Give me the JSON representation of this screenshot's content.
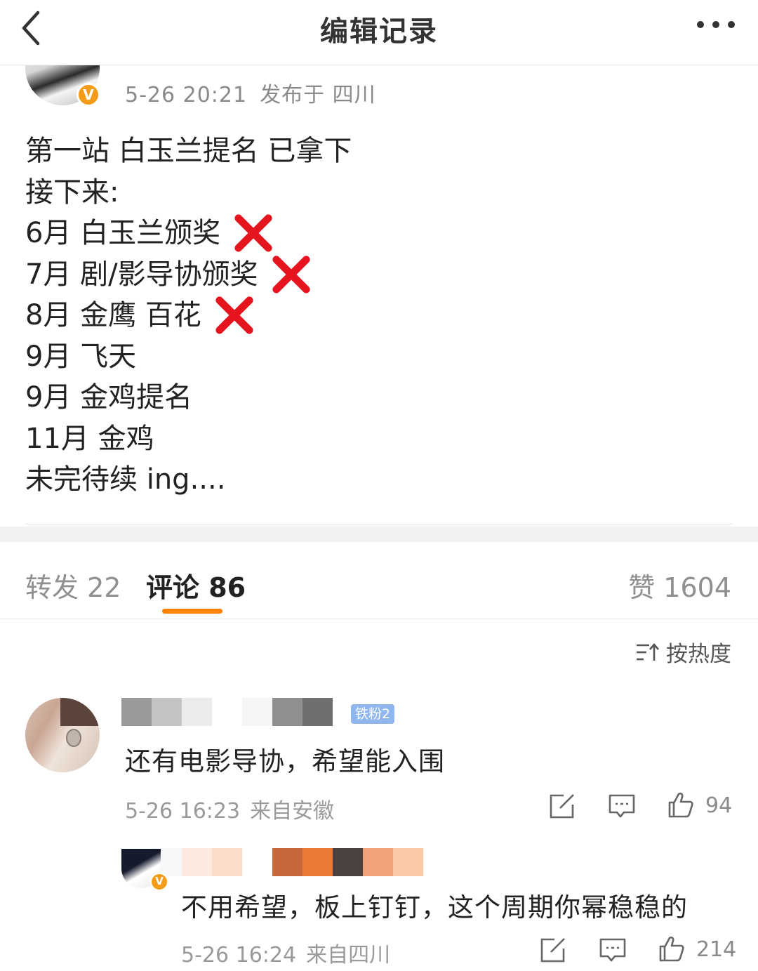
{
  "nav": {
    "title": "编辑记录",
    "back_icon": "chevron-left-icon",
    "more_icon": "more-horizontal-icon"
  },
  "post": {
    "time": "5-26 20:21",
    "location": "发布于 四川",
    "verify_badge": "V",
    "lines": [
      {
        "text": "第一站 白玉兰提名 已拿下",
        "crossed": false
      },
      {
        "text": "接下来:",
        "crossed": false
      },
      {
        "text": "6月 白玉兰颁奖",
        "crossed": true
      },
      {
        "text": "7月 剧/影导协颁奖",
        "crossed": true
      },
      {
        "text": "8月 金鹰 百花",
        "crossed": true
      },
      {
        "text": "9月 飞天",
        "crossed": false
      },
      {
        "text": "9月 金鸡提名",
        "crossed": false
      },
      {
        "text": "11月 金鸡",
        "crossed": false
      },
      {
        "text": "未完待续 ing....",
        "crossed": false
      }
    ]
  },
  "tabs": {
    "repost": "转发 22",
    "comments": "评论 86",
    "likes": "赞 1604"
  },
  "sort": {
    "label": "按热度",
    "icon": "sort-icon"
  },
  "comments": [
    {
      "fan_badge": "铁粉2",
      "text": "还有电影导协，希望能入围",
      "time": "5-26 16:23",
      "location": "来自安徽",
      "likes": "94"
    },
    {
      "verify_badge": "V",
      "text": "不用希望，板上钉钉，这个周期你幂稳稳的",
      "time": "5-26 16:24",
      "location": "来自四川",
      "likes": "214"
    }
  ],
  "colors": {
    "accent_orange": "#ff8200",
    "cross_red": "#e5141e",
    "verify_orange": "#f49b18",
    "fan_badge_blue": "#8fb6ee",
    "meta_gray": "#9a9a9a"
  }
}
